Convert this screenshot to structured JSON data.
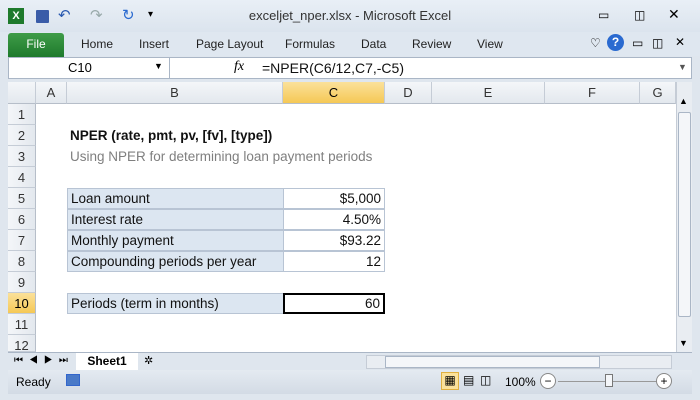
{
  "window": {
    "title": "exceljet_nper.xlsx  -  Microsoft Excel"
  },
  "ribbon": {
    "tabs": [
      "File",
      "Home",
      "Insert",
      "Page Layout",
      "Formulas",
      "Data",
      "Review",
      "View"
    ]
  },
  "formula_bar": {
    "name_box": "C10",
    "fx": "fx",
    "formula": "=NPER(C6/12,C7,-C5)"
  },
  "columns": [
    "A",
    "B",
    "C",
    "D",
    "E",
    "F",
    "G"
  ],
  "rows": [
    "1",
    "2",
    "3",
    "4",
    "5",
    "6",
    "7",
    "8",
    "9",
    "10",
    "11",
    "12"
  ],
  "sheet": {
    "title": "NPER (rate, pmt, pv, [fv], [type])",
    "subtitle": "Using NPER for determining loan payment periods",
    "table": [
      {
        "label": "Loan amount",
        "value": "$5,000"
      },
      {
        "label": "Interest rate",
        "value": "4.50%"
      },
      {
        "label": "Monthly payment",
        "value": "$93.22"
      },
      {
        "label": "Compounding periods per year",
        "value": "12"
      }
    ],
    "result": {
      "label": "Periods (term in months)",
      "value": "60"
    }
  },
  "sheet_tabs": [
    "Sheet1"
  ],
  "status": {
    "ready": "Ready",
    "zoom": "100%",
    "zoom_level_percent": 100
  },
  "colors": {
    "file_tab": "#2a8a36",
    "label_fill": "#dce6f1",
    "selected_header": "#f5c855"
  }
}
